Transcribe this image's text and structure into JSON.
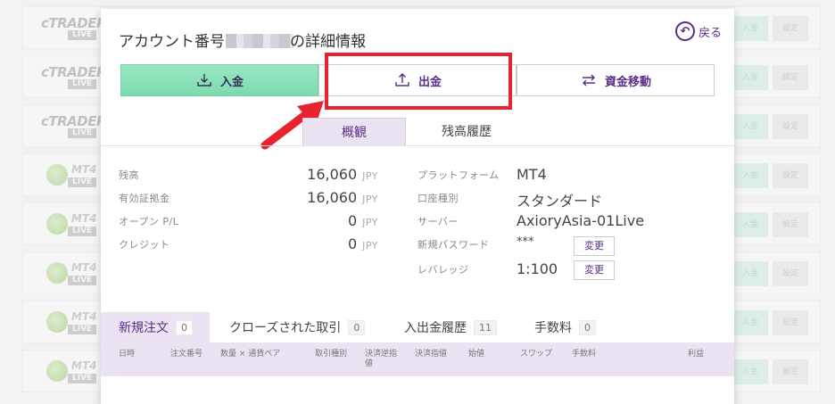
{
  "background_rows": [
    {
      "logo": "cTRADER",
      "tag": "LIVE",
      "deposit": "入金",
      "settings": "設定"
    },
    {
      "logo": "cTRADER",
      "tag": "LIVE",
      "deposit": "入金",
      "settings": "設定"
    },
    {
      "logo": "cTRADER",
      "tag": "LIVE",
      "deposit": "入金",
      "settings": "設定"
    },
    {
      "logo": "MT4",
      "tag": "LIVE",
      "deposit": "入金",
      "settings": "設定"
    },
    {
      "logo": "MT4",
      "tag": "LIVE",
      "deposit": "入金",
      "settings": "設定"
    },
    {
      "logo": "MT4",
      "tag": "LIVE",
      "deposit": "入金",
      "settings": "設定"
    },
    {
      "logo": "MT4",
      "tag": "LIVE",
      "deposit": "入金",
      "settings": "設定"
    },
    {
      "logo": "MT4",
      "tag": "LIVE",
      "deposit": "入金",
      "settings": "設定"
    }
  ],
  "modal": {
    "title_prefix": "アカウント番号",
    "title_suffix": "の詳細情報",
    "back_label": "戻る"
  },
  "actions": {
    "deposit": "入金",
    "withdraw": "出金",
    "transfer": "資金移動"
  },
  "colors": {
    "accent": "#5a2d86",
    "deposit_green": "#7ed9ae",
    "highlight_red": "#e8222e"
  },
  "subtabs": {
    "overview": "概観",
    "balance_history": "残高履歴"
  },
  "account": {
    "balance_label": "残高",
    "balance": "16,060",
    "balance_unit": "JPY",
    "equity_label": "有効証拠金",
    "equity": "16,060",
    "equity_unit": "JPY",
    "open_pl_label": "オープン P/L",
    "open_pl": "0",
    "open_pl_unit": "JPY",
    "credit_label": "クレジット",
    "credit": "0",
    "credit_unit": "JPY",
    "platform_label": "プラットフォーム",
    "platform": "MT4",
    "type_label": "口座種別",
    "type": "スタンダード",
    "server_label": "サーバー",
    "server": "AxioryAsia-01Live",
    "password_label": "新規パスワード",
    "password": "***",
    "password_change": "変更",
    "leverage_label": "レバレッジ",
    "leverage": "1:100",
    "leverage_change": "変更"
  },
  "order_tabs": [
    {
      "label": "新規注文",
      "count": "0"
    },
    {
      "label": "クローズされた取引",
      "count": "0"
    },
    {
      "label": "入出金履歴",
      "count": "11"
    },
    {
      "label": "手数料",
      "count": "0"
    }
  ],
  "table_headers": [
    "日時",
    "注文番号",
    "数量 × 通貨ペア",
    "取引種別",
    "決済逆指値",
    "決済指値",
    "始値",
    "スワップ",
    "手数料",
    "利益"
  ]
}
